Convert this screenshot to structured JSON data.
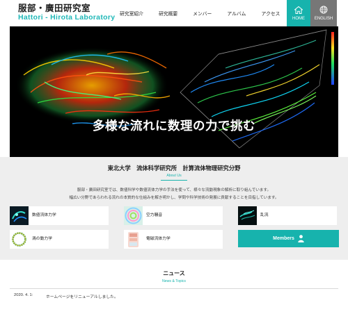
{
  "header": {
    "logo_jp": "服部・廣田研究室",
    "logo_en": "Hattori - Hirota Laboratory",
    "nav": [
      {
        "label": "研究室紹介"
      },
      {
        "label": "研究概要"
      },
      {
        "label": "メンバー"
      },
      {
        "label": "アルバム"
      },
      {
        "label": "アクセス"
      }
    ],
    "home_label": "HOME",
    "english_label": "ENGLISH",
    "accent_color": "#17b3ad",
    "english_bg": "#777777"
  },
  "hero": {
    "title": "多様な流れに数理の力で挑む"
  },
  "about": {
    "title": "東北大学　流体科学研究所　計算流体物理研究分野",
    "subtitle": "About Us",
    "text_lines": [
      "服部・廣田研究室では、数値科学や数値流体力学の手法を使って、様々な流動現象の解析に取り組んでいます。",
      "幅広い分野であらわれる流れの本質的な仕組みを解き明かし、学問や科学技術の発展に貢献することを目指しています。"
    ],
    "cards": [
      {
        "label": "数値流体力学",
        "icon": "vortex-thumbnail"
      },
      {
        "label": "空力騒音",
        "icon": "sound-wave-thumbnail"
      },
      {
        "label": "乱流",
        "icon": "turbulence-thumbnail"
      },
      {
        "label": "渦の動力学",
        "icon": "vortex-ring-thumbnail"
      },
      {
        "label": "電磁流体力学",
        "icon": "plasma-thumbnail"
      }
    ],
    "members_label": "Members",
    "members_icon": "person-icon"
  },
  "news": {
    "title": "ニュース",
    "subtitle": "News & Topics",
    "items": [
      {
        "date": "2020. 4. 1:",
        "text": "ホームページをリニューアルしました。"
      }
    ]
  }
}
